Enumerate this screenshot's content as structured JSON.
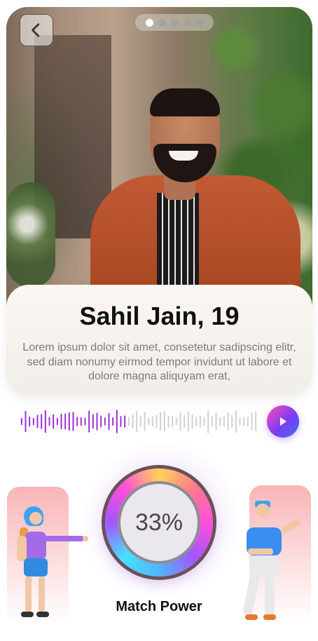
{
  "profile": {
    "name_age": "Sahil Jain, 19",
    "bio": "Lorem ipsum dolor sit amet, consetetur sadipscing elitr, sed diam nonumy eirmod tempor invidunt ut labore et dolore magna aliquyam erat,"
  },
  "carousel": {
    "total_pages": 5,
    "active_page": 1
  },
  "audio": {
    "played_fraction": 0.45
  },
  "match": {
    "percent_label": "33%",
    "label": "Match Power",
    "value": 0.33
  },
  "colors": {
    "accent_purple": "#7b3cf2",
    "accent_pink": "#ff4fb6",
    "wave_played": "#9b2fd6",
    "wave_unplayed": "#d0d0d0"
  },
  "icons": {
    "back": "chevron-left-icon",
    "play": "play-icon"
  }
}
